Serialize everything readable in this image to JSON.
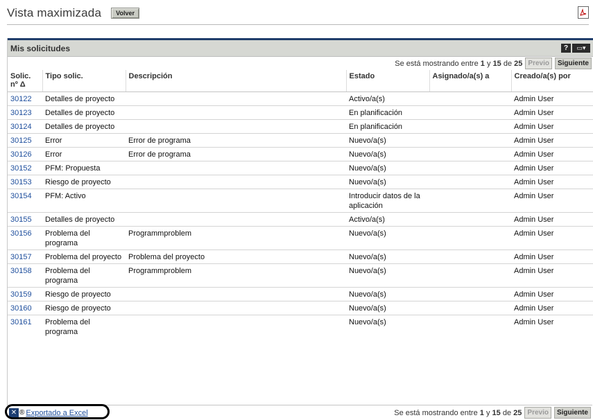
{
  "page": {
    "title": "Vista maximizada",
    "back_label": "Volver"
  },
  "portlet": {
    "title": "Mis solicitudes",
    "pager": {
      "prefix": "Se está mostrando entre",
      "from": "1",
      "and": "y",
      "to": "15",
      "of": "de",
      "total": "25",
      "prev": "Previo",
      "next": "Siguiente"
    },
    "columns": [
      "Solic. nº Δ",
      "Tipo solic.",
      "Descripción",
      "Estado",
      "Asignado/a(s) a",
      "Creado/a(s) por"
    ],
    "rows": [
      {
        "id": "30122",
        "type": "Detalles de proyecto",
        "desc": "",
        "status": "Activo/a(s)",
        "assigned": "",
        "created": "Admin User"
      },
      {
        "id": "30123",
        "type": "Detalles de proyecto",
        "desc": "",
        "status": "En planificación",
        "assigned": "",
        "created": "Admin User"
      },
      {
        "id": "30124",
        "type": "Detalles de proyecto",
        "desc": "",
        "status": "En planificación",
        "assigned": "",
        "created": "Admin User"
      },
      {
        "id": "30125",
        "type": "Error",
        "desc": "Error de programa",
        "status": "Nuevo/a(s)",
        "assigned": "",
        "created": "Admin User"
      },
      {
        "id": "30126",
        "type": "Error",
        "desc": "Error de programa",
        "status": "Nuevo/a(s)",
        "assigned": "",
        "created": "Admin User"
      },
      {
        "id": "30152",
        "type": "PFM: Propuesta",
        "desc": "",
        "status": "Nuevo/a(s)",
        "assigned": "",
        "created": "Admin User"
      },
      {
        "id": "30153",
        "type": "Riesgo de proyecto",
        "desc": "",
        "status": "Nuevo/a(s)",
        "assigned": "",
        "created": "Admin User"
      },
      {
        "id": "30154",
        "type": "PFM: Activo",
        "desc": "",
        "status": "Introducir datos de la aplicación",
        "assigned": "",
        "created": "Admin User"
      },
      {
        "id": "30155",
        "type": "Detalles de proyecto",
        "desc": "",
        "status": "Activo/a(s)",
        "assigned": "",
        "created": "Admin User"
      },
      {
        "id": "30156",
        "type": "Problema del programa",
        "desc": "Programmproblem",
        "status": "Nuevo/a(s)",
        "assigned": "",
        "created": "Admin User"
      },
      {
        "id": "30157",
        "type": "Problema del proyecto",
        "desc": "Problema del proyecto",
        "status": "Nuevo/a(s)",
        "assigned": "",
        "created": "Admin User"
      },
      {
        "id": "30158",
        "type": "Problema del programa",
        "desc": "Programmproblem",
        "status": "Nuevo/a(s)",
        "assigned": "",
        "created": "Admin User"
      },
      {
        "id": "30159",
        "type": "Riesgo de proyecto",
        "desc": "",
        "status": "Nuevo/a(s)",
        "assigned": "",
        "created": "Admin User"
      },
      {
        "id": "30160",
        "type": "Riesgo de proyecto",
        "desc": "",
        "status": "Nuevo/a(s)",
        "assigned": "",
        "created": "Admin User"
      },
      {
        "id": "30161",
        "type": "Problema del programa",
        "desc": "",
        "status": "Nuevo/a(s)",
        "assigned": "",
        "created": "Admin User"
      }
    ]
  },
  "footer": {
    "export_label": "Exportado a Excel",
    "reg_mark": "®"
  },
  "icons": {
    "pdf": "pdf-icon",
    "excel": "excel-icon",
    "help": "help-icon",
    "menu": "menu-icon"
  },
  "colors": {
    "accent": "#1f3d6a",
    "link": "#1f4f9d",
    "header_bg": "#d6d8d3"
  }
}
